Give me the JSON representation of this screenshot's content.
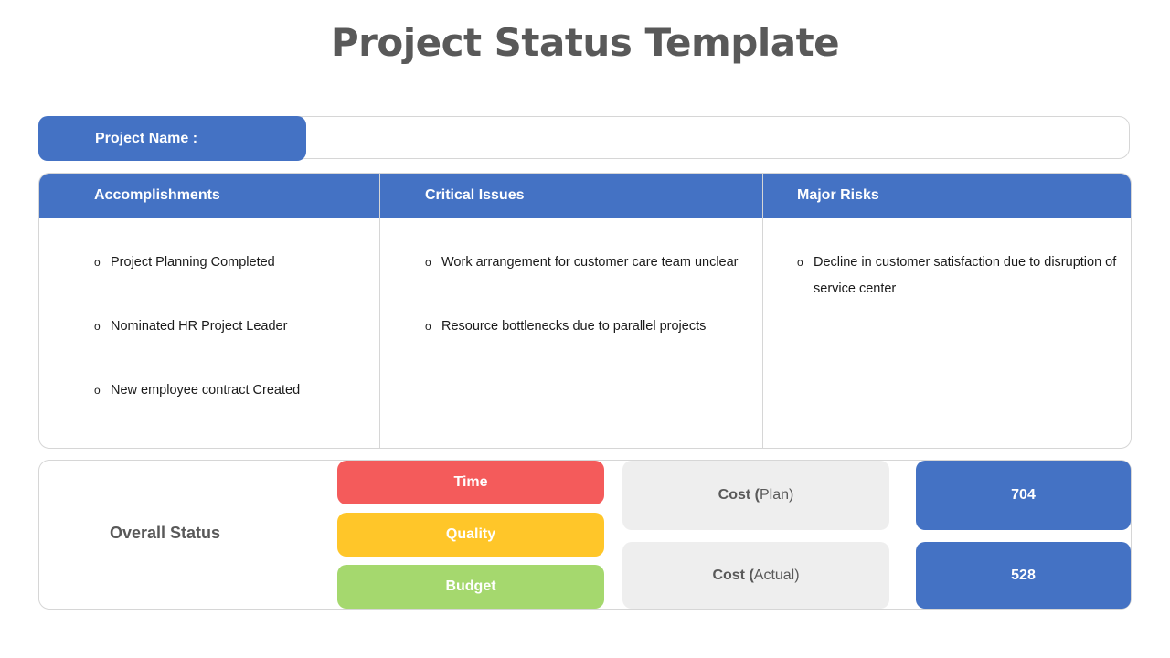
{
  "title": "Project Status Template",
  "project_name": {
    "label": "Project Name :",
    "value": ""
  },
  "columns": [
    {
      "header": "Accomplishments",
      "items": [
        "Project Planning Completed",
        "Nominated HR Project Leader",
        "New employee contract Created"
      ]
    },
    {
      "header": "Critical Issues",
      "items": [
        "Work arrangement for customer care team unclear",
        "Resource bottlenecks due to parallel projects"
      ]
    },
    {
      "header": "Major Risks",
      "items": [
        "Decline in customer satisfaction due to disruption of service center"
      ]
    }
  ],
  "bullet_glyph": "o",
  "overall_status": {
    "label": "Overall Status",
    "indicators": [
      {
        "label": "Time",
        "color": "#f45b5b"
      },
      {
        "label": "Quality",
        "color": "#ffc629"
      },
      {
        "label": "Budget",
        "color": "#a5d86e"
      }
    ]
  },
  "costs": {
    "plan": {
      "label_bold": "Cost (",
      "label_rest": "Plan)",
      "value": "704"
    },
    "actual": {
      "label_bold": "Cost (",
      "label_rest": "Actual)",
      "value": "528"
    }
  },
  "colors": {
    "accent": "#4472c4",
    "cost_box": "#eeeeee",
    "title": "#595959"
  }
}
